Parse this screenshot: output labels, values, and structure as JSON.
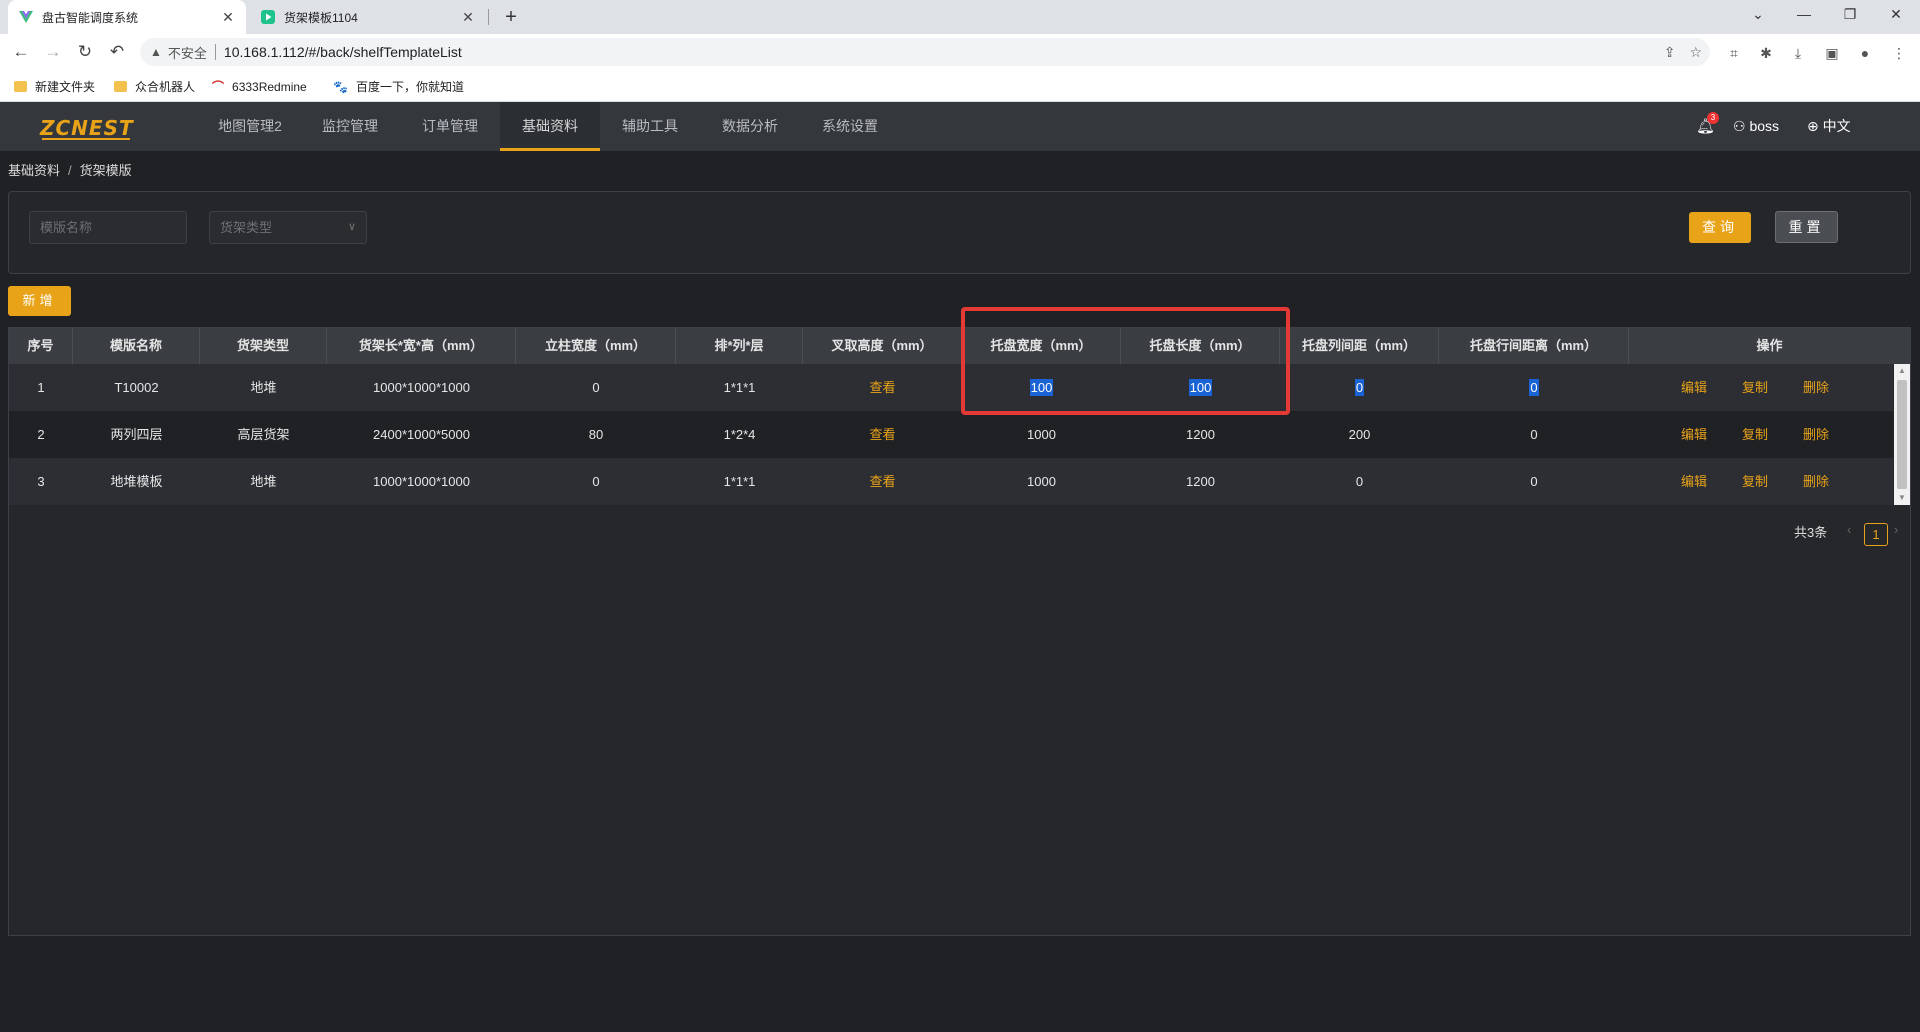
{
  "browser": {
    "tabs": [
      {
        "title": "盘古智能调度系统",
        "active": true
      },
      {
        "title": "货架模板1104",
        "active": false
      }
    ],
    "insecure_label": "不安全",
    "url": "10.168.1.112/#/back/shelfTemplateList",
    "bookmarks": [
      "新建文件夹",
      "众合机器人",
      "6333Redmine",
      "百度一下，你就知道"
    ]
  },
  "app": {
    "logo": "ZCNEST",
    "menu": [
      "地图管理2",
      "监控管理",
      "订单管理",
      "基础资料",
      "辅助工具",
      "数据分析",
      "系统设置"
    ],
    "active_menu": "基础资料",
    "notification_count": "3",
    "user": "boss",
    "language": "中文"
  },
  "breadcrumb": {
    "parent": "基础资料",
    "separator": "/",
    "current": "货架模版"
  },
  "filters": {
    "template_name_placeholder": "模版名称",
    "shelf_type_placeholder": "货架类型",
    "query_label": "查询",
    "reset_label": "重置"
  },
  "add_label": "新增",
  "table": {
    "columns": [
      "序号",
      "模版名称",
      "货架类型",
      "货架长*宽*高（mm）",
      "立柱宽度（mm）",
      "排*列*层",
      "叉取高度（mm）",
      "托盘宽度（mm）",
      "托盘长度（mm）",
      "托盘列间距（mm）",
      "托盘行间距离（mm）",
      "操作"
    ],
    "rows": [
      {
        "index": "1",
        "name": "T10002",
        "type": "地堆",
        "size": "1000*1000*1000",
        "column_width": "0",
        "layout": "1*1*1",
        "fork_height": "查看",
        "pallet_width": "100",
        "pallet_length": "100",
        "pallet_col_gap": "0",
        "pallet_row_gap": "0"
      },
      {
        "index": "2",
        "name": "两列四层",
        "type": "高层货架",
        "size": "2400*1000*5000",
        "column_width": "80",
        "layout": "1*2*4",
        "fork_height": "查看",
        "pallet_width": "1000",
        "pallet_length": "1200",
        "pallet_col_gap": "200",
        "pallet_row_gap": "0"
      },
      {
        "index": "3",
        "name": "地堆模板",
        "type": "地堆",
        "size": "1000*1000*1000",
        "column_width": "0",
        "layout": "1*1*1",
        "fork_height": "查看",
        "pallet_width": "1000",
        "pallet_length": "1200",
        "pallet_col_gap": "0",
        "pallet_row_gap": "0"
      }
    ],
    "actions": [
      "编辑",
      "复制",
      "删除"
    ]
  },
  "pagination": {
    "total_text": "共3条",
    "current_page": "1"
  }
}
